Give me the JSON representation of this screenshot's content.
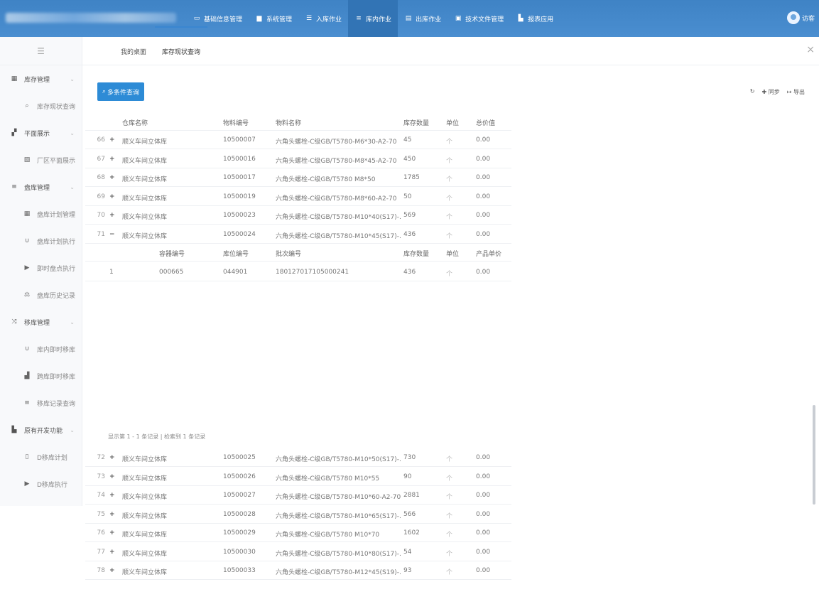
{
  "nav": {
    "items": [
      {
        "label": "基础信息管理",
        "icon": "monitor-icon"
      },
      {
        "label": "系统管理",
        "icon": "system-icon"
      },
      {
        "label": "入库作业",
        "icon": "inbound-icon"
      },
      {
        "label": "库内作业",
        "icon": "list-icon",
        "active": true
      },
      {
        "label": "出库作业",
        "icon": "outbound-icon"
      },
      {
        "label": "技术文件管理",
        "icon": "file-icon"
      },
      {
        "label": "报表应用",
        "icon": "chart-icon"
      }
    ],
    "user_name": "访客"
  },
  "sidebar": {
    "groups": [
      {
        "label": "库存管理",
        "icon": "inventory-icon",
        "items": [
          {
            "label": "库存现状查询",
            "icon": "search-icon"
          }
        ]
      },
      {
        "label": "平面展示",
        "icon": "plan-icon",
        "items": [
          {
            "label": "厂区平面展示",
            "icon": "image-icon"
          }
        ]
      },
      {
        "label": "盘库管理",
        "icon": "menu-icon",
        "items": [
          {
            "label": "盘库计划管理",
            "icon": "grid-icon"
          },
          {
            "label": "盘库计划执行",
            "icon": "magnet-icon"
          },
          {
            "label": "即时盘点执行",
            "icon": "play-icon"
          },
          {
            "label": "盘库历史记录",
            "icon": "scale-icon"
          }
        ]
      },
      {
        "label": "移库管理",
        "icon": "shuffle-icon",
        "items": [
          {
            "label": "库内即时移库",
            "icon": "magnet-icon"
          },
          {
            "label": "跨库即时移库",
            "icon": "truck-icon"
          },
          {
            "label": "移库记录查询",
            "icon": "list-icon"
          }
        ]
      },
      {
        "label": "原有开发功能",
        "icon": "area-chart-icon",
        "items": [
          {
            "label": "D移库计划",
            "icon": "doc-icon"
          },
          {
            "label": "D移库执行",
            "icon": "play-icon"
          }
        ]
      }
    ]
  },
  "tabs": [
    {
      "label": "我的桌面"
    },
    {
      "label": "库存现状查询",
      "active": true
    }
  ],
  "toolbar": {
    "query_button": "多条件查询",
    "sync_label": "同步",
    "export_label": "导出"
  },
  "table": {
    "headers": [
      "仓库名称",
      "物料编号",
      "物料名称",
      "库存数量",
      "单位",
      "总价值"
    ],
    "rows_top": [
      {
        "num": "66",
        "toggle": "+",
        "warehouse": "顺义车间立体库",
        "code": "10500007",
        "name": "六角头螺栓-C级GB/T5780-M6*30-A2-70",
        "qty": "45",
        "unit": "个",
        "value": "0.00"
      },
      {
        "num": "67",
        "toggle": "+",
        "warehouse": "顺义车间立体库",
        "code": "10500016",
        "name": "六角头螺栓-C级GB/T5780-M8*45-A2-70",
        "qty": "450",
        "unit": "个",
        "value": "0.00"
      },
      {
        "num": "68",
        "toggle": "+",
        "warehouse": "顺义车间立体库",
        "code": "10500017",
        "name": "六角头螺栓-C级GB/T5780 M8*50",
        "qty": "1785",
        "unit": "个",
        "value": "0.00"
      },
      {
        "num": "69",
        "toggle": "+",
        "warehouse": "顺义车间立体库",
        "code": "10500019",
        "name": "六角头螺栓-C级GB/T5780-M8*60-A2-70",
        "qty": "50",
        "unit": "个",
        "value": "0.00"
      },
      {
        "num": "70",
        "toggle": "+",
        "warehouse": "顺义车间立体库",
        "code": "10500023",
        "name": "六角头螺栓-C级GB/T5780-M10*40(S17)-...",
        "qty": "569",
        "unit": "个",
        "value": "0.00"
      },
      {
        "num": "71",
        "toggle": "−",
        "warehouse": "顺义车间立体库",
        "code": "10500024",
        "name": "六角头螺栓-C级GB/T5780-M10*45(S17)-...",
        "qty": "436",
        "unit": "个",
        "value": "0.00"
      }
    ],
    "sub_headers": [
      "容器编号",
      "库位编号",
      "批次编号",
      "库存数量",
      "单位",
      "产品单价"
    ],
    "sub_rows": [
      {
        "num": "1",
        "container": "000665",
        "location": "044901",
        "batch": "180127017105000241",
        "qty": "436",
        "unit": "个",
        "price": "0.00"
      }
    ],
    "pager_text": "显示第 1 - 1 条记录 | 检索到 1 条记录",
    "rows_bottom": [
      {
        "num": "72",
        "toggle": "+",
        "warehouse": "顺义车间立体库",
        "code": "10500025",
        "name": "六角头螺栓-C级GB/T5780-M10*50(S17)-...",
        "qty": "730",
        "unit": "个",
        "value": "0.00"
      },
      {
        "num": "73",
        "toggle": "+",
        "warehouse": "顺义车间立体库",
        "code": "10500026",
        "name": "六角头螺栓-C级GB/T5780 M10*55",
        "qty": "90",
        "unit": "个",
        "value": "0.00"
      },
      {
        "num": "74",
        "toggle": "+",
        "warehouse": "顺义车间立体库",
        "code": "10500027",
        "name": "六角头螺栓-C级GB/T5780-M10*60-A2-70",
        "qty": "2881",
        "unit": "个",
        "value": "0.00"
      },
      {
        "num": "75",
        "toggle": "+",
        "warehouse": "顺义车间立体库",
        "code": "10500028",
        "name": "六角头螺栓-C级GB/T5780-M10*65(S17)-...",
        "qty": "566",
        "unit": "个",
        "value": "0.00"
      },
      {
        "num": "76",
        "toggle": "+",
        "warehouse": "顺义车间立体库",
        "code": "10500029",
        "name": "六角头螺栓-C级GB/T5780 M10*70",
        "qty": "1602",
        "unit": "个",
        "value": "0.00"
      },
      {
        "num": "77",
        "toggle": "+",
        "warehouse": "顺义车间立体库",
        "code": "10500030",
        "name": "六角头螺栓-C级GB/T5780-M10*80(S17)-...",
        "qty": "54",
        "unit": "个",
        "value": "0.00"
      },
      {
        "num": "78",
        "toggle": "+",
        "warehouse": "顺义车间立体库",
        "code": "10500033",
        "name": "六角头螺栓-C级GB/T5780-M12*45(S19)-...",
        "qty": "93",
        "unit": "个",
        "value": "0.00"
      }
    ]
  }
}
